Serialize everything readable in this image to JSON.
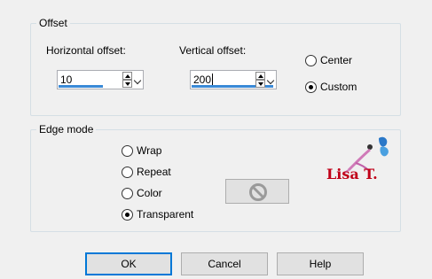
{
  "offset": {
    "title": "Offset",
    "horizontal_label": "Horizontal offset:",
    "horizontal_value": "10",
    "vertical_label": "Vertical offset:",
    "vertical_value": "200",
    "options": [
      {
        "label": "Center",
        "selected": false
      },
      {
        "label": "Custom",
        "selected": true
      }
    ]
  },
  "edge_mode": {
    "title": "Edge mode",
    "options": [
      {
        "label": "Wrap",
        "selected": false
      },
      {
        "label": "Repeat",
        "selected": false
      },
      {
        "label": "Color",
        "selected": false
      },
      {
        "label": "Transparent",
        "selected": true
      }
    ]
  },
  "logo": {
    "text": "Lisa T."
  },
  "buttons": {
    "ok": "OK",
    "cancel": "Cancel",
    "help": "Help"
  },
  "colors": {
    "accent": "#0078d7",
    "logo_red": "#c00018",
    "logo_blue": "#2a78c8",
    "logo_pink": "#d07ab8"
  }
}
